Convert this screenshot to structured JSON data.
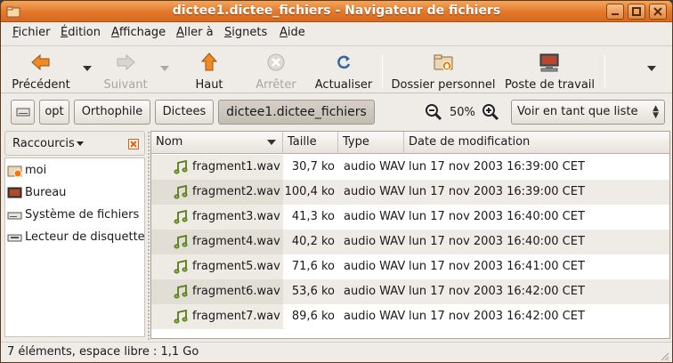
{
  "window": {
    "title": "dictee1.dictee_fichiers - Navigateur de fichiers"
  },
  "menu": {
    "items": [
      {
        "first": "F",
        "rest": "ichier"
      },
      {
        "first": "É",
        "rest": "dition"
      },
      {
        "first": "A",
        "rest": "ffichage"
      },
      {
        "first": "A",
        "rest": "ller à"
      },
      {
        "first": "S",
        "rest": "ignets"
      },
      {
        "first": "A",
        "rest": "ide"
      }
    ]
  },
  "toolbar": {
    "back": "Précédent",
    "forward": "Suivant",
    "up": "Haut",
    "stop": "Arrêter",
    "reload": "Actualiser",
    "home": "Dossier personnel",
    "computer": "Poste de travail"
  },
  "location": {
    "crumbs": [
      "opt",
      "Orthophile",
      "Dictees",
      "dictee1.dictee_fichiers"
    ],
    "zoom": "50%",
    "view_mode": "Voir en tant que liste"
  },
  "sidebar": {
    "title": "Raccourcis",
    "items": [
      "moi",
      "Bureau",
      "Système de fichiers",
      "Lecteur de disquette"
    ]
  },
  "columns": {
    "name": "Nom",
    "size": "Taille",
    "type": "Type",
    "date": "Date de modification"
  },
  "files": [
    {
      "name": "fragment1.wav",
      "size": "30,7 ko",
      "type": "audio WAV",
      "date": "lun 17 nov 2003 16:39:00 CET"
    },
    {
      "name": "fragment2.wav",
      "size": "100,4 ko",
      "type": "audio WAV",
      "date": "lun 17 nov 2003 16:39:00 CET"
    },
    {
      "name": "fragment3.wav",
      "size": "41,3 ko",
      "type": "audio WAV",
      "date": "lun 17 nov 2003 16:40:00 CET"
    },
    {
      "name": "fragment4.wav",
      "size": "40,2 ko",
      "type": "audio WAV",
      "date": "lun 17 nov 2003 16:40:00 CET"
    },
    {
      "name": "fragment5.wav",
      "size": "71,6 ko",
      "type": "audio WAV",
      "date": "lun 17 nov 2003 16:41:00 CET"
    },
    {
      "name": "fragment6.wav",
      "size": "53,6 ko",
      "type": "audio WAV",
      "date": "lun 17 nov 2003 16:42:00 CET"
    },
    {
      "name": "fragment7.wav",
      "size": "89,6 ko",
      "type": "audio WAV",
      "date": "lun 17 nov 2003 16:42:00 CET"
    }
  ],
  "status": {
    "text": "7 éléments, espace libre : 1,1 Go"
  },
  "colors": {
    "titlebar": "#e2772a",
    "window_bg": "#efebe7",
    "row_alt": "#efebe7"
  }
}
